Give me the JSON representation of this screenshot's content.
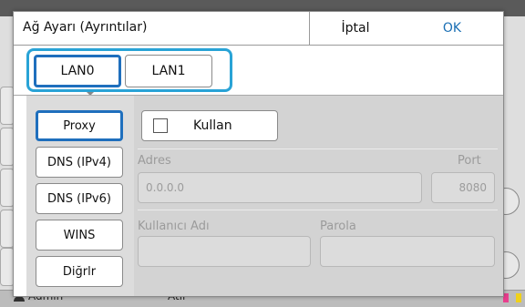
{
  "background": {
    "user_name": "Admin",
    "status_text": "Atıl",
    "ink_colors": [
      "#e83f8e",
      "#f0d11a"
    ]
  },
  "dialog": {
    "title": "Ağ Ayarı (Ayrıntılar)",
    "cancel_label": "İptal",
    "ok_label": "OK"
  },
  "lan_tabs": [
    {
      "label": "LAN0",
      "active": true
    },
    {
      "label": "LAN1",
      "active": false
    }
  ],
  "side_menu": [
    {
      "label": "Proxy",
      "active": true
    },
    {
      "label": "DNS (IPv4)",
      "active": false
    },
    {
      "label": "DNS (IPv6)",
      "active": false
    },
    {
      "label": "WINS",
      "active": false
    },
    {
      "label": "Diğrlr",
      "active": false
    }
  ],
  "proxy": {
    "use_label": "Kullan",
    "use_checked": false,
    "address_label": "Adres",
    "address_value": "0.0.0.0",
    "port_label": "Port",
    "port_value": "8080",
    "username_label": "Kullanıcı Adı",
    "username_value": "",
    "password_label": "Parola",
    "password_value": ""
  },
  "colors": {
    "accent_blue": "#1f6fbd",
    "highlight_cyan": "#29a3d6",
    "ok_text": "#1a6fb4"
  }
}
